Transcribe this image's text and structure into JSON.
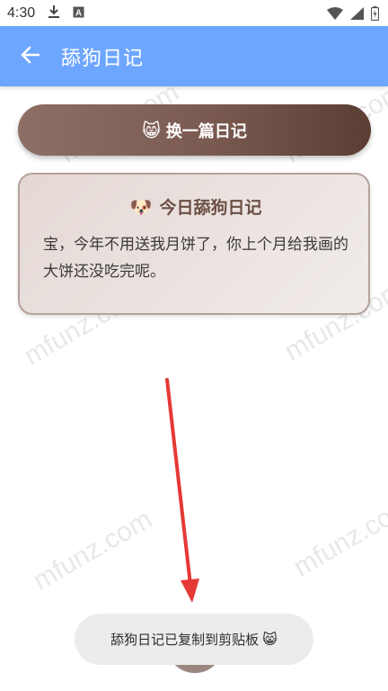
{
  "status_bar": {
    "time": "4:30",
    "icons": [
      "download-icon",
      "a-box-icon",
      "wifi-icon",
      "signal-icon",
      "battery-charging-icon"
    ]
  },
  "app_bar": {
    "back_icon": "arrow-left-icon",
    "title": "舔狗日记",
    "color": "#6da6ff"
  },
  "watermark": "mfunz.com",
  "change_button": {
    "emoji": "😸",
    "label": "换一篇日记"
  },
  "card": {
    "emoji": "🐶",
    "title": "今日舔狗日记",
    "body": "宝，今年不用送我月饼了，你上个月给我画的大饼还没吃完呢。"
  },
  "toast": {
    "text": "舔狗日记已复制到剪贴板",
    "emoji": "😸"
  },
  "colors": {
    "button_start": "#8d6f66",
    "button_end": "#5a3d33",
    "card_border": "#b7a19b",
    "arrow": "#e53935"
  }
}
